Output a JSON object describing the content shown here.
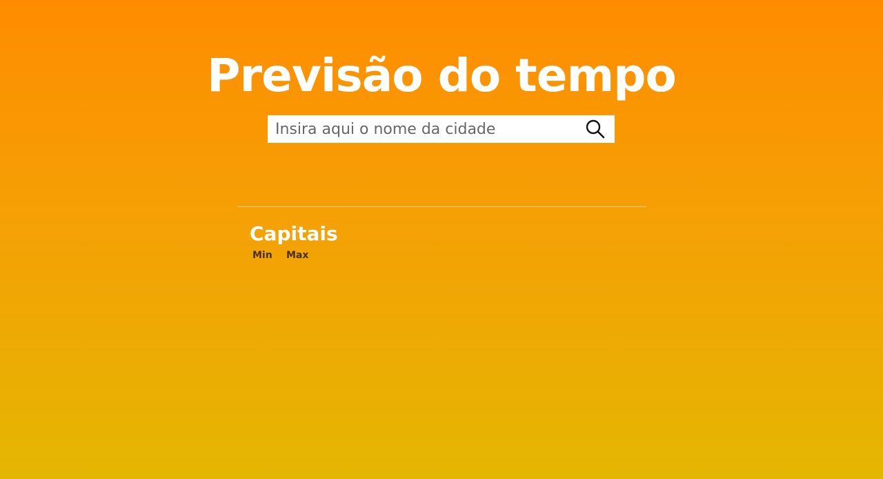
{
  "header": {
    "title": "Previsão do tempo"
  },
  "search": {
    "placeholder": "Insira aqui o nome da cidade",
    "value": "",
    "button_icon": "search-icon"
  },
  "capitals": {
    "title": "Capitais",
    "columns": [
      "Min",
      "Max"
    ]
  },
  "colors": {
    "gradient_top": "#ff8c00",
    "gradient_bottom": "#e4b602",
    "text_primary": "#ffffff"
  }
}
